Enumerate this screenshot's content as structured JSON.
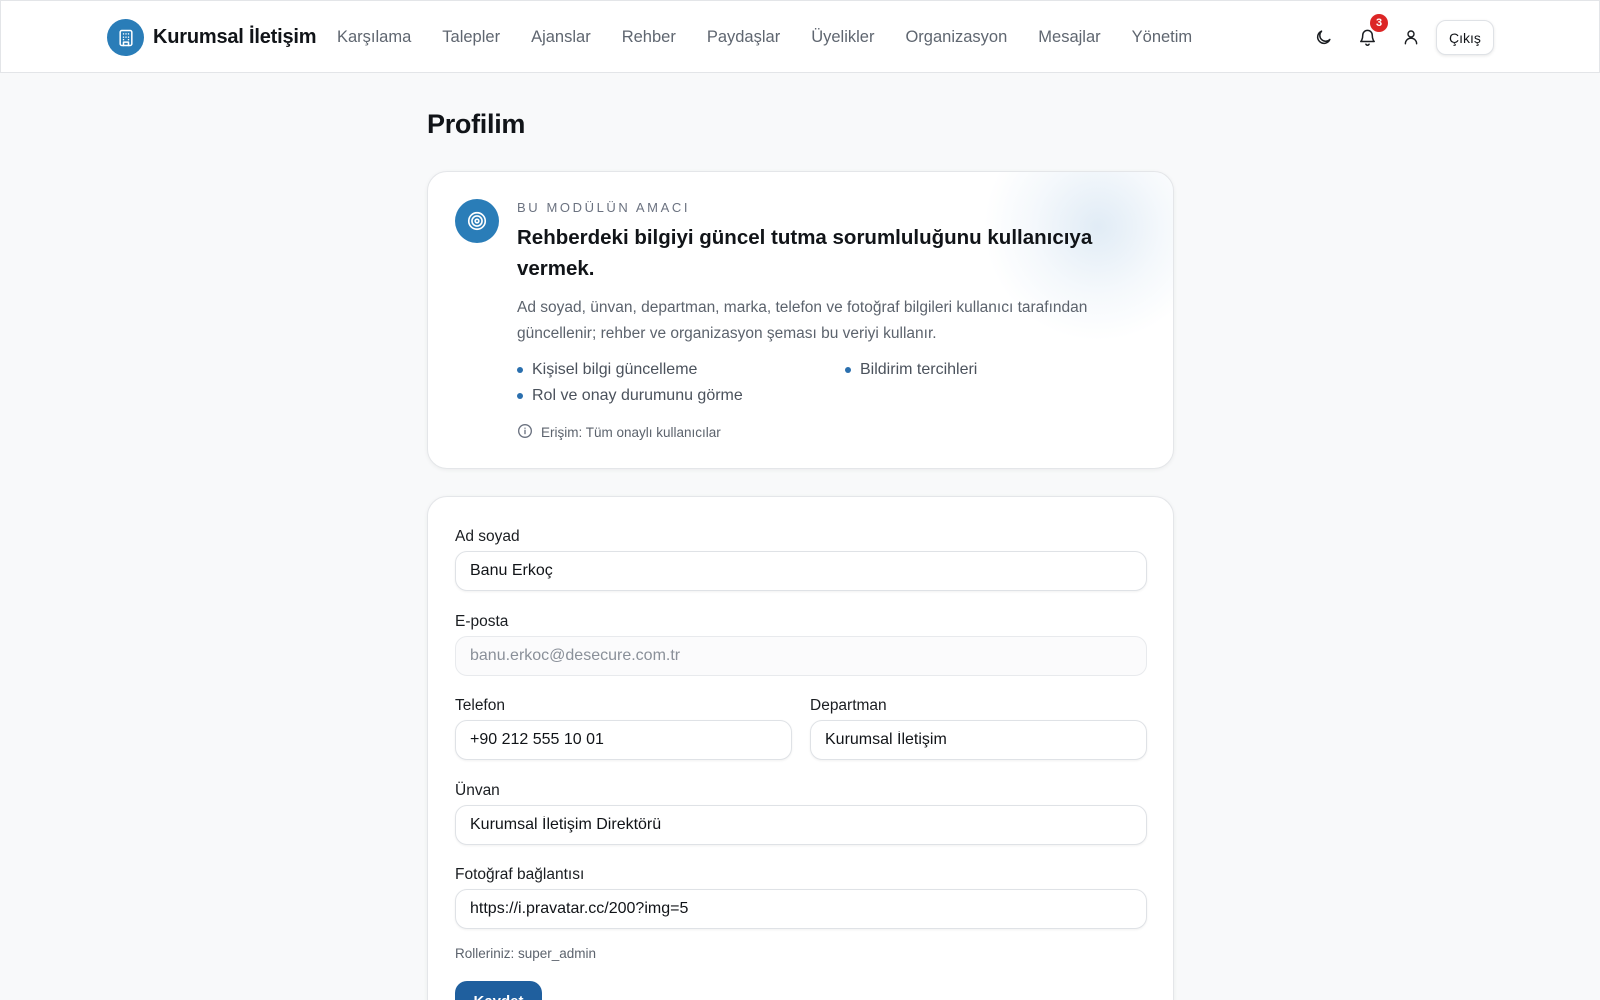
{
  "app": {
    "brand_name": "Kurumsal İletişim",
    "accent_color": "#2a7db8"
  },
  "nav": {
    "items": [
      {
        "label": "Karşılama"
      },
      {
        "label": "Talepler"
      },
      {
        "label": "Ajanslar"
      },
      {
        "label": "Rehber"
      },
      {
        "label": "Paydaşlar"
      },
      {
        "label": "Üyelikler"
      },
      {
        "label": "Organizasyon"
      },
      {
        "label": "Mesajlar"
      },
      {
        "label": "Yönetim"
      }
    ]
  },
  "header_actions": {
    "theme_icon": "moon-icon",
    "notifications_icon": "bell-icon",
    "notification_count": "3",
    "profile_icon": "user-icon",
    "logout_label": "Çıkış"
  },
  "page": {
    "title": "Profilim"
  },
  "purpose": {
    "icon": "target-icon",
    "eyebrow": "BU MODÜLÜN AMACI",
    "title": "Rehberdeki bilgiyi güncel tutma sorumluluğunu kullanıcıya vermek.",
    "description": "Ad soyad, ünvan, departman, marka, telefon ve fotoğraf bilgileri kullanıcı tarafından güncellenir; rehber ve organizasyon şeması bu veriyi kullanır.",
    "features": [
      "Kişisel bilgi güncelleme",
      "Bildirim tercihleri",
      "Rol ve onay durumunu görme"
    ],
    "access_icon": "info-icon",
    "access": "Erişim: Tüm onaylı kullanıcılar"
  },
  "form": {
    "name": {
      "label": "Ad soyad",
      "value": "Banu Erkoç"
    },
    "email": {
      "label": "E-posta",
      "value": "banu.erkoc@desecure.com.tr"
    },
    "phone": {
      "label": "Telefon",
      "value": "+90 212 555 10 01"
    },
    "department": {
      "label": "Departman",
      "value": "Kurumsal İletişim"
    },
    "title": {
      "label": "Ünvan",
      "value": "Kurumsal İletişim Direktörü"
    },
    "photo": {
      "label": "Fotoğraf bağlantısı",
      "value": "https://i.pravatar.cc/200?img=5"
    },
    "roles": "Rolleriniz: super_admin",
    "save_label": "Kaydet"
  }
}
